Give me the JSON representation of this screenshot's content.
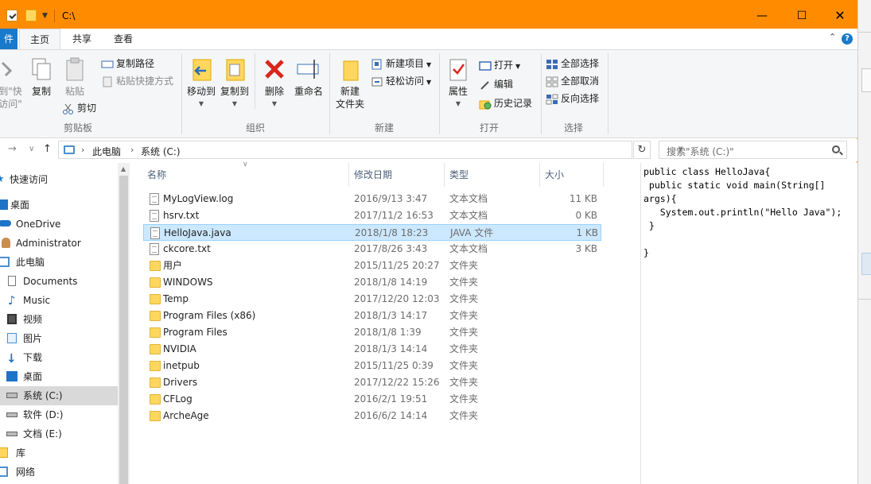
{
  "window": {
    "title": "C:\\"
  },
  "ribbon": {
    "tabs": [
      {
        "label": "件"
      },
      {
        "label": "主页"
      },
      {
        "label": "共享"
      },
      {
        "label": "查看"
      }
    ],
    "help_label": "?",
    "groups": {
      "clipboard": {
        "label": "剪贴板",
        "pin_quick_access_line1": "到\"快",
        "pin_quick_access_line2": "访问\"",
        "copy": "复制",
        "paste": "粘贴",
        "copy_path": "复制路径",
        "paste_shortcut": "粘贴快捷方式",
        "cut": "剪切"
      },
      "organize": {
        "label": "组织",
        "move_to": "移动到",
        "copy_to": "复制到",
        "delete": "删除",
        "rename": "重命名"
      },
      "new": {
        "label": "新建",
        "new_folder_line1": "新建",
        "new_folder_line2": "文件夹",
        "new_item": "新建项目",
        "easy_access": "轻松访问"
      },
      "open": {
        "label": "打开",
        "properties": "属性",
        "open": "打开",
        "edit": "编辑",
        "history": "历史记录"
      },
      "select": {
        "label": "选择",
        "select_all": "全部选择",
        "select_none": "全部取消",
        "invert_selection": "反向选择"
      }
    }
  },
  "address": {
    "crumbs": [
      "此电脑",
      "系统 (C:)"
    ],
    "search_placeholder": "搜索\"系统 (C:)\""
  },
  "nav": {
    "items": [
      {
        "label": "快速访问"
      },
      {
        "label": "桌面"
      },
      {
        "label": "OneDrive"
      },
      {
        "label": "Administrator"
      },
      {
        "label": "此电脑"
      },
      {
        "label": "Documents"
      },
      {
        "label": "Music"
      },
      {
        "label": "视频"
      },
      {
        "label": "图片"
      },
      {
        "label": "下载"
      },
      {
        "label": "桌面"
      },
      {
        "label": "系统 (C:)"
      },
      {
        "label": "软件 (D:)"
      },
      {
        "label": "文档 (E:)"
      },
      {
        "label": "库"
      },
      {
        "label": "网络"
      }
    ]
  },
  "file_list": {
    "columns": {
      "name": "名称",
      "date": "修改日期",
      "type": "类型",
      "size": "大小"
    },
    "rows": [
      {
        "name": "MyLogView.log",
        "date": "2016/9/13 3:47",
        "type": "文本文档",
        "size": "11 KB",
        "kind": "doc"
      },
      {
        "name": "hsrv.txt",
        "date": "2017/11/2 16:53",
        "type": "文本文档",
        "size": "0 KB",
        "kind": "doc"
      },
      {
        "name": "HelloJava.java",
        "date": "2018/1/8 18:23",
        "type": "JAVA 文件",
        "size": "1 KB",
        "kind": "doc",
        "selected": true
      },
      {
        "name": "ckcore.txt",
        "date": "2017/8/26 3:43",
        "type": "文本文档",
        "size": "3 KB",
        "kind": "doc"
      },
      {
        "name": "用户",
        "date": "2015/11/25 20:27",
        "type": "文件夹",
        "size": "",
        "kind": "folder"
      },
      {
        "name": "WINDOWS",
        "date": "2018/1/8 14:19",
        "type": "文件夹",
        "size": "",
        "kind": "folder"
      },
      {
        "name": "Temp",
        "date": "2017/12/20 12:03",
        "type": "文件夹",
        "size": "",
        "kind": "folder"
      },
      {
        "name": "Program Files (x86)",
        "date": "2018/1/3 14:17",
        "type": "文件夹",
        "size": "",
        "kind": "folder"
      },
      {
        "name": "Program Files",
        "date": "2018/1/8 1:39",
        "type": "文件夹",
        "size": "",
        "kind": "folder"
      },
      {
        "name": "NVIDIA",
        "date": "2018/1/3 14:14",
        "type": "文件夹",
        "size": "",
        "kind": "folder"
      },
      {
        "name": "inetpub",
        "date": "2015/11/25 0:39",
        "type": "文件夹",
        "size": "",
        "kind": "folder"
      },
      {
        "name": "Drivers",
        "date": "2017/12/22 15:26",
        "type": "文件夹",
        "size": "",
        "kind": "folder"
      },
      {
        "name": "CFLog",
        "date": "2016/2/1 19:51",
        "type": "文件夹",
        "size": "",
        "kind": "folder"
      },
      {
        "name": "ArcheAge",
        "date": "2016/6/2 14:14",
        "type": "文件夹",
        "size": "",
        "kind": "folder"
      }
    ]
  },
  "preview": {
    "code": "public class HelloJava{\n public static void main(String[]\nargs){\n   System.out.println(\"Hello Java\");\n }\n\n}"
  },
  "colors": {
    "title_bar": "#ff8c00",
    "accent": "#1979ca",
    "selection": "#cce8ff"
  }
}
